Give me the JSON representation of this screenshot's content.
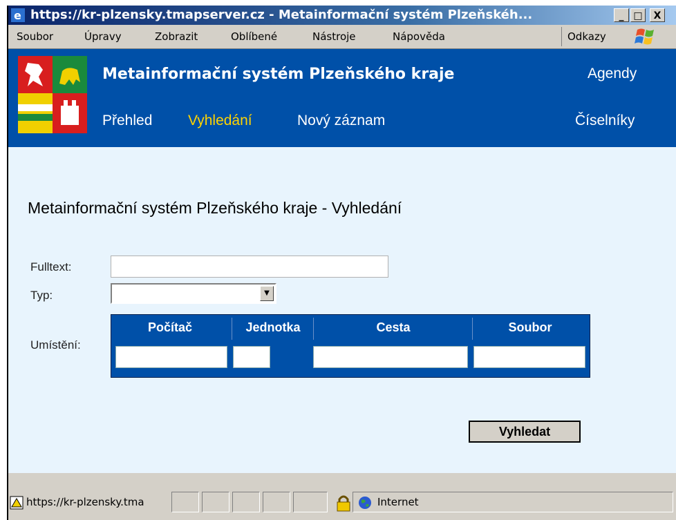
{
  "window": {
    "title": "https://kr-plzensky.tmapserver.cz - Metainformační systém Plzeňskéh...",
    "minimize": "_",
    "maximize": "□",
    "close": "X"
  },
  "menu": {
    "items": [
      "Soubor",
      "Úpravy",
      "Zobrazit",
      "Oblíbené",
      "Nástroje",
      "Nápověda"
    ],
    "links_label": "Odkazy"
  },
  "header": {
    "title": "Metainformační systém Plzeňského kraje",
    "nav": [
      "Přehled",
      "Vyhledání",
      "Nový záznam"
    ],
    "right_links": [
      "Agendy",
      "Číselníky"
    ],
    "colors": {
      "background": "#0050a8",
      "active_nav": "#ffd400"
    }
  },
  "main": {
    "title": "Metainformační systém Plzeňského kraje - Vyhledání",
    "fulltext_label": "Fulltext:",
    "fulltext_value": "",
    "type_label": "Typ:",
    "type_value": "",
    "location_label": "Umístění:",
    "location_headers": [
      "Počítač",
      "Jednotka",
      "Cesta",
      "Soubor"
    ],
    "search_button": "Vyhledat"
  },
  "status": {
    "url": "https://kr-plzensky.tma",
    "zone": "Internet"
  }
}
